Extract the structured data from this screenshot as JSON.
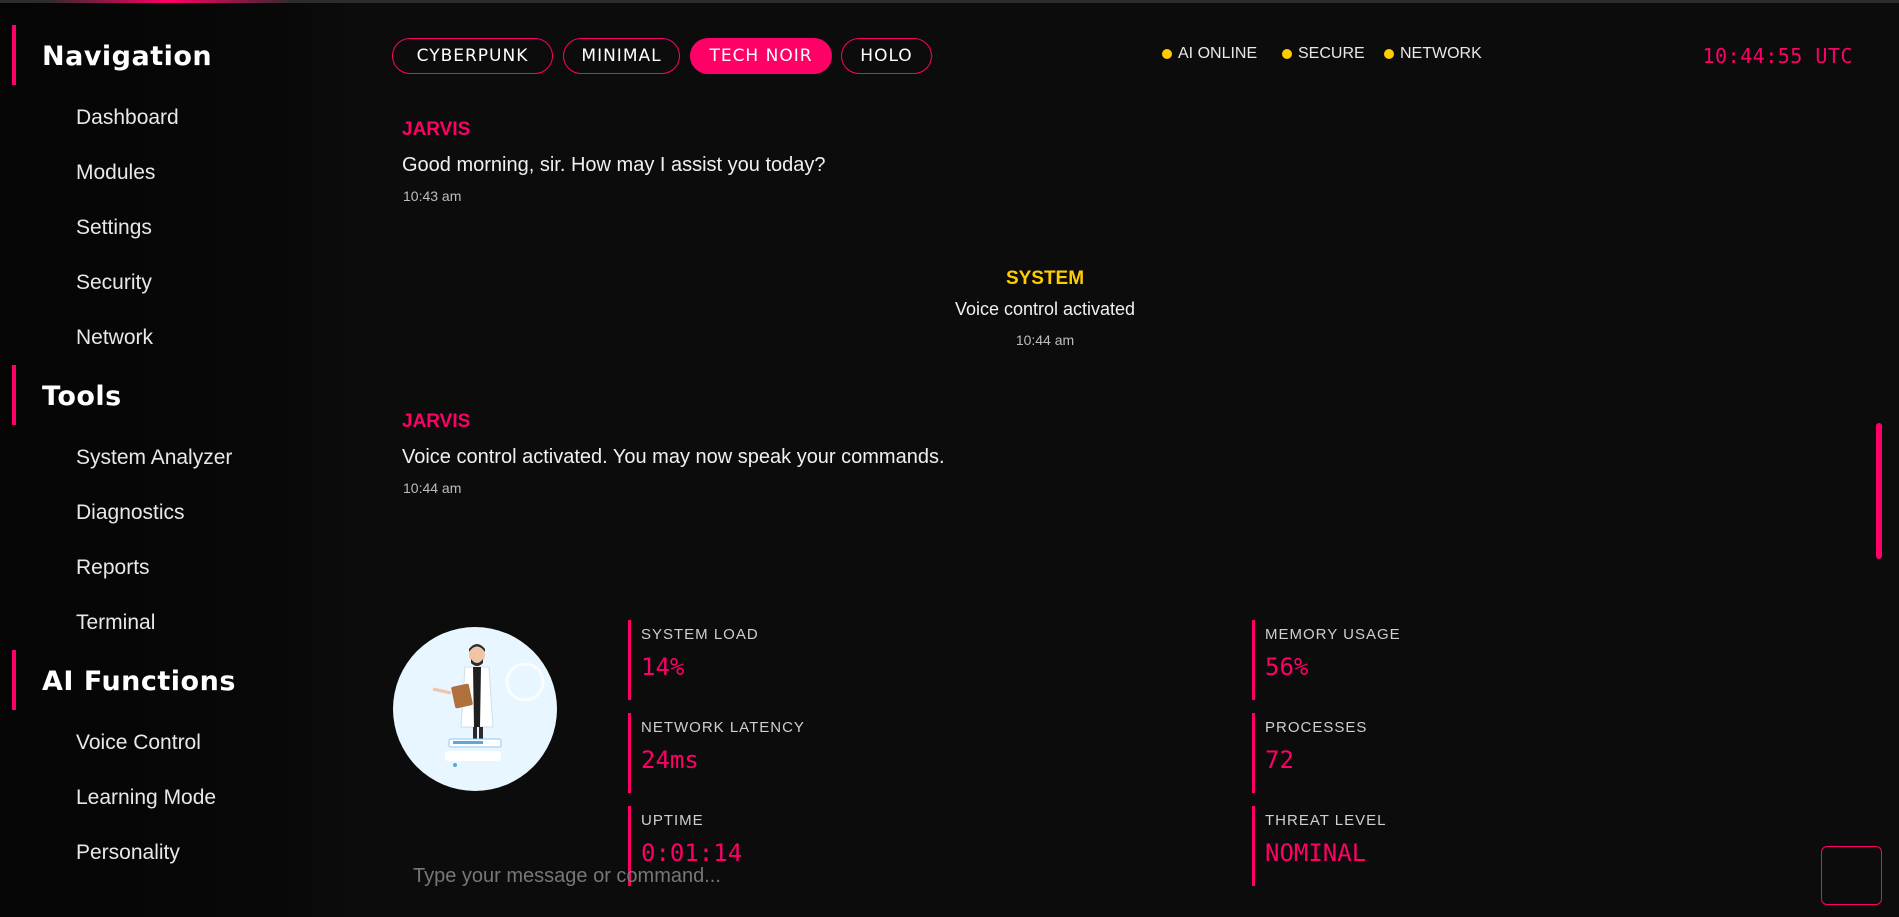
{
  "sidebar": {
    "sections": [
      {
        "title": "Navigation",
        "items": [
          "Dashboard",
          "Modules",
          "Settings",
          "Security",
          "Network"
        ]
      },
      {
        "title": "Tools",
        "items": [
          "System Analyzer",
          "Diagnostics",
          "Reports",
          "Terminal"
        ]
      },
      {
        "title": "AI Functions",
        "items": [
          "Voice Control",
          "Learning Mode",
          "Personality"
        ]
      }
    ]
  },
  "header": {
    "themes": [
      "CYBERPUNK",
      "MINIMAL",
      "TECH NOIR",
      "HOLO"
    ],
    "active_theme": "TECH NOIR",
    "status": [
      "AI ONLINE",
      "SECURE",
      "NETWORK"
    ],
    "clock": "10:44:55 UTC"
  },
  "messages": [
    {
      "sender": "JARVIS",
      "text": "Good morning, sir. How may I assist you today?",
      "time": "10:43 am"
    },
    {
      "sender": "SYSTEM",
      "text": "Voice control activated",
      "time": "10:44 am"
    },
    {
      "sender": "JARVIS",
      "text": "Voice control activated. You may now speak your commands.",
      "time": "10:44 am"
    }
  ],
  "stats": [
    {
      "label": "SYSTEM LOAD",
      "value": "14%"
    },
    {
      "label": "MEMORY USAGE",
      "value": "56%"
    },
    {
      "label": "NETWORK LATENCY",
      "value": "24ms"
    },
    {
      "label": "PROCESSES",
      "value": "72"
    },
    {
      "label": "UPTIME",
      "value": "0:01:14"
    },
    {
      "label": "THREAT LEVEL",
      "value": "NOMINAL"
    }
  ],
  "input": {
    "placeholder": "Type your message or command..."
  },
  "colors": {
    "accent": "#ff0066",
    "status_dot": "#ffcc00",
    "system": "#ffcc00",
    "background": "#0c0c0c"
  },
  "icons": {
    "send": "send-icon",
    "avatar": "doctor-avatar"
  }
}
